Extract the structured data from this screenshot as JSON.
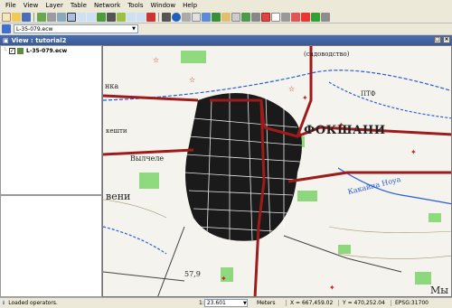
{
  "menu": [
    "File",
    "View",
    "Layer",
    "Table",
    "Network",
    "Tools",
    "Window",
    "Help"
  ],
  "layer_selector": {
    "value": "L-35-079.ecw"
  },
  "view": {
    "title": "View : tutorial2"
  },
  "toc": {
    "layers": [
      {
        "name": "L-35-079.ecw",
        "checked": true
      }
    ]
  },
  "map": {
    "labels": {
      "city": "ФОКШАНИ",
      "vylcele": "Вылчеле",
      "kakaina": "Какайна Ноуа",
      "keshti": "кешти",
      "veni": "вени",
      "nka": "нка",
      "my": "Мы",
      "ptf": "ПТФ",
      "sovkh": "(садоводство)",
      "num579": "57,9"
    }
  },
  "status": {
    "message": "Loaded operators.",
    "scale_prefix": "1:",
    "scale": "23.601",
    "units": "Meters",
    "x": "X = 667,459.02",
    "y": "Y = 470,252.04",
    "epsg": "EPSG:31700"
  },
  "colors": {
    "road": "#9e1b1b",
    "water": "#2a5bd7",
    "forest": "#7cd36a",
    "urban": "#111111"
  }
}
